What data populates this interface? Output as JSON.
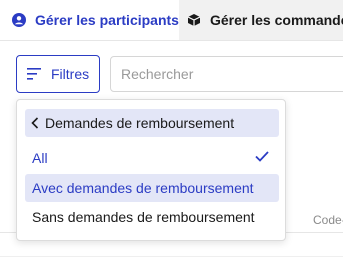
{
  "tabs": [
    {
      "label": "Gérer les participants",
      "icon": "user-circle-icon",
      "active": true
    },
    {
      "label": "Gérer les commandes",
      "icon": "box-icon",
      "active": false
    }
  ],
  "toolbar": {
    "filter_label": "Filtres",
    "search_placeholder": "Rechercher"
  },
  "dropdown": {
    "header": "Demandes de remboursement",
    "options": [
      {
        "label": "All",
        "selected": true
      },
      {
        "label": "Avec demandes de remboursement",
        "selected": false,
        "highlighted": true
      },
      {
        "label": "Sans demandes de remboursement",
        "selected": false
      }
    ]
  },
  "table": {
    "partial_column_header": "Code-"
  },
  "colors": {
    "accent": "#2b3cc4",
    "highlight": "#e3e6f7"
  }
}
